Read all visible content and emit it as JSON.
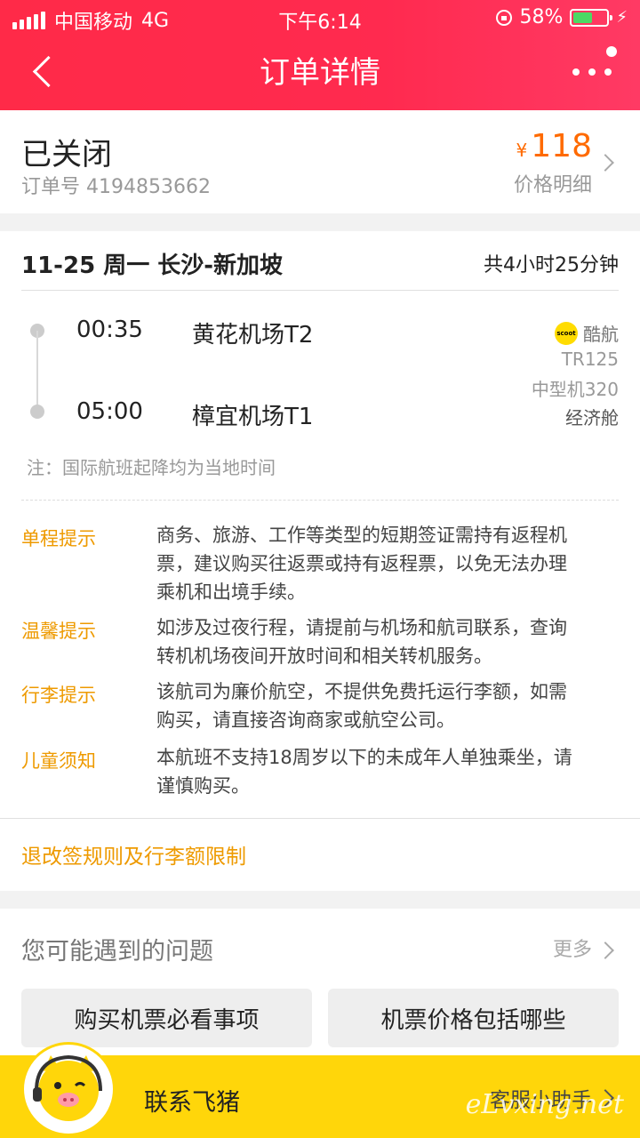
{
  "status_bar": {
    "carrier": "中国移动",
    "network": "4G",
    "time": "下午6:14",
    "battery_percent": "58%",
    "battery_level": 0.58
  },
  "nav": {
    "title": "订单详情"
  },
  "order": {
    "status": "已关闭",
    "order_number": "订单号 4194853662",
    "currency": "¥",
    "price": "118",
    "price_detail_label": "价格明细"
  },
  "flight": {
    "route": "11-25 周一 长沙-新加坡",
    "duration": "共4小时25分钟",
    "departure_time": "00:35",
    "departure_airport": "黄花机场T2",
    "arrival_time": "05:00",
    "arrival_airport": "樟宜机场T1",
    "airline_logo_text": "scoot",
    "airline": "酷航",
    "flight_number": "TR125",
    "aircraft": "中型机320",
    "cabin": "经济舱",
    "note": "注：国际航班起降均为当地时间"
  },
  "tips": [
    {
      "label": "单程提示",
      "lines": [
        "商务、旅游、工作等类型的短期签证需持有返程机",
        "票，建议购买往返票或持有返程票，以免无法办理",
        "乘机和出境手续。"
      ]
    },
    {
      "label": "温馨提示",
      "lines": [
        "如涉及过夜行程，请提前与机场和航司联系，查询",
        "转机机场夜间开放时间和相关转机服务。"
      ]
    },
    {
      "label": "行李提示",
      "lines": [
        "该航司为廉价航空，不提供免费托运行李额，如需",
        "购买，请直接咨询商家或航空公司。"
      ]
    },
    {
      "label": "儿童须知",
      "lines": [
        "本航班不支持18周岁以下的未成年人单独乘坐，请",
        "谨慎购买。"
      ]
    }
  ],
  "rules_link": "退改签规则及行李额限制",
  "faq": {
    "title": "您可能遇到的问题",
    "more": "更多",
    "buttons": [
      "购买机票必看事项",
      "机票价格包括哪些"
    ]
  },
  "bottom": {
    "contact": "联系飞猪",
    "assistant": "客服小助手",
    "watermark": "eLvxing.net"
  },
  "colors": {
    "header": "#ff2a48",
    "accent_orange": "#ee9a00",
    "price": "#ff6a00",
    "bottom_bar": "#ffd60a"
  }
}
